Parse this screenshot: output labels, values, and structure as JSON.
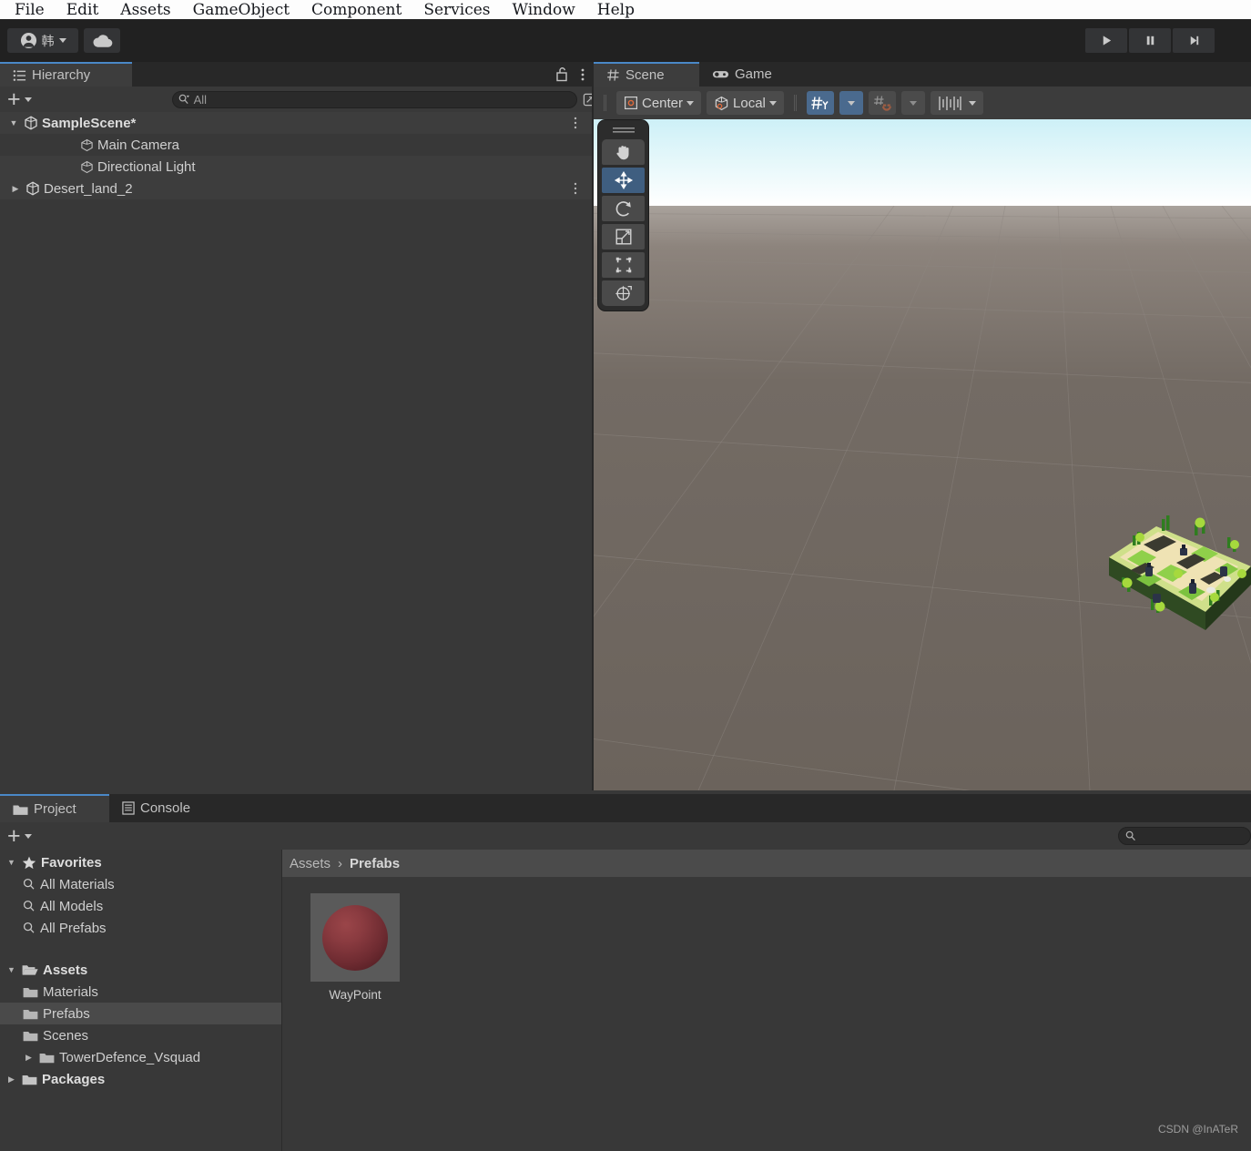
{
  "menubar": {
    "items": [
      "File",
      "Edit",
      "Assets",
      "GameObject",
      "Component",
      "Services",
      "Window",
      "Help"
    ]
  },
  "toolbar": {
    "account_label": "韩",
    "account_icon": "user-circle-icon",
    "cloud_icon": "cloud-icon",
    "play_label": "play-icon",
    "pause_label": "pause-icon",
    "step_label": "step-icon"
  },
  "hierarchy": {
    "tab_label": "Hierarchy",
    "tab_icon": "hierarchy-icon",
    "lock_icon": "lock-open-icon",
    "menu_icon": "kebab-menu-icon",
    "add_icon": "plus-icon",
    "search_placeholder": "All",
    "search_value": "",
    "search_icon": "search-filter-icon",
    "expand_icon": "expand-window-icon",
    "items": [
      {
        "label": "SampleScene*",
        "icon": "unity-scene-icon",
        "indent": 0,
        "twisty": "down",
        "bold": true,
        "has_menu": true
      },
      {
        "label": "Main Camera",
        "icon": "gameobject-cube-icon",
        "indent": 1,
        "twisty": "",
        "bold": false,
        "has_menu": false
      },
      {
        "label": "Directional Light",
        "icon": "gameobject-cube-icon",
        "indent": 1,
        "twisty": "",
        "bold": false,
        "has_menu": false
      },
      {
        "label": "Desert_land_2",
        "icon": "unity-scene-icon",
        "indent": 0,
        "twisty": "right",
        "bold": false,
        "has_menu": true
      }
    ]
  },
  "scene": {
    "tabs": [
      {
        "label": "Scene",
        "icon": "grid-hash-icon",
        "active": true
      },
      {
        "label": "Game",
        "icon": "gamepad-icon",
        "active": false
      }
    ],
    "toolbar": {
      "pivot_mode": "Center",
      "pivot_icon": "pivot-center-icon",
      "pivot_caret": "chevron-down-icon",
      "handle_space": "Local",
      "handle_icon": "local-space-cube-icon",
      "handle_caret": "chevron-down-icon",
      "grid_axis_icon": "grid-axis-y-icon",
      "grid_axis_active": true,
      "grid_axis_caret": "chevron-down-icon",
      "grid_snap_icon": "grid-snap-magnet-icon",
      "grid_snap_active": false,
      "grid_snap_caret": "chevron-down-icon",
      "snap_increment_icon": "snap-increment-ruler-icon",
      "snap_increment_caret": "chevron-down-icon"
    },
    "tools": [
      {
        "name": "drag-handle",
        "icon": "drag-handle-icon",
        "selected": false
      },
      {
        "name": "hand-tool",
        "icon": "hand-icon",
        "selected": false
      },
      {
        "name": "move-tool",
        "icon": "move-arrows-icon",
        "selected": true
      },
      {
        "name": "rotate-tool",
        "icon": "rotate-icon",
        "selected": false
      },
      {
        "name": "scale-tool",
        "icon": "scale-icon",
        "selected": false
      },
      {
        "name": "rect-tool",
        "icon": "rect-transform-icon",
        "selected": false
      },
      {
        "name": "transform-tool",
        "icon": "transform-combined-icon",
        "selected": false
      }
    ],
    "sky_color_top": "#cdf0f7",
    "sky_color_horizon": "#ffffff",
    "ground_color": "#6b635c",
    "content_description": "Desert_land_2 voxel tower-defence map"
  },
  "project": {
    "tabs": [
      {
        "label": "Project",
        "icon": "folder-icon",
        "active": true
      },
      {
        "label": "Console",
        "icon": "console-icon",
        "active": false
      }
    ],
    "add_icon": "plus-icon",
    "search_placeholder": "",
    "search_value": "",
    "search_icon": "search-icon",
    "tree": [
      {
        "label": "Favorites",
        "icon": "star-icon",
        "indent": 0,
        "twisty": "down",
        "bold": true,
        "selected": false
      },
      {
        "label": "All Materials",
        "icon": "search-icon",
        "indent": 1,
        "twisty": "",
        "bold": false,
        "selected": false
      },
      {
        "label": "All Models",
        "icon": "search-icon",
        "indent": 1,
        "twisty": "",
        "bold": false,
        "selected": false
      },
      {
        "label": "All Prefabs",
        "icon": "search-icon",
        "indent": 1,
        "twisty": "",
        "bold": false,
        "selected": false
      },
      {
        "label": "",
        "icon": "",
        "indent": 0,
        "twisty": "",
        "bold": false,
        "selected": false
      },
      {
        "label": "Assets",
        "icon": "folder-open-icon",
        "indent": 0,
        "twisty": "down",
        "bold": true,
        "selected": false
      },
      {
        "label": "Materials",
        "icon": "folder-icon",
        "indent": 1,
        "twisty": "",
        "bold": false,
        "selected": false
      },
      {
        "label": "Prefabs",
        "icon": "folder-icon",
        "indent": 1,
        "twisty": "",
        "bold": false,
        "selected": true
      },
      {
        "label": "Scenes",
        "icon": "folder-icon",
        "indent": 1,
        "twisty": "",
        "bold": false,
        "selected": false
      },
      {
        "label": "TowerDefence_Vsquad",
        "icon": "folder-icon",
        "indent": 1,
        "twisty": "right",
        "bold": false,
        "selected": false
      },
      {
        "label": "Packages",
        "icon": "folder-icon",
        "indent": 0,
        "twisty": "right",
        "bold": true,
        "selected": false
      }
    ],
    "breadcrumb": {
      "root": "Assets",
      "separator": "›",
      "current": "Prefabs"
    },
    "assets": [
      {
        "name": "WayPoint",
        "type": "prefab-sphere",
        "color": "#8a3b40"
      }
    ]
  },
  "watermark": "CSDN @InATeR"
}
